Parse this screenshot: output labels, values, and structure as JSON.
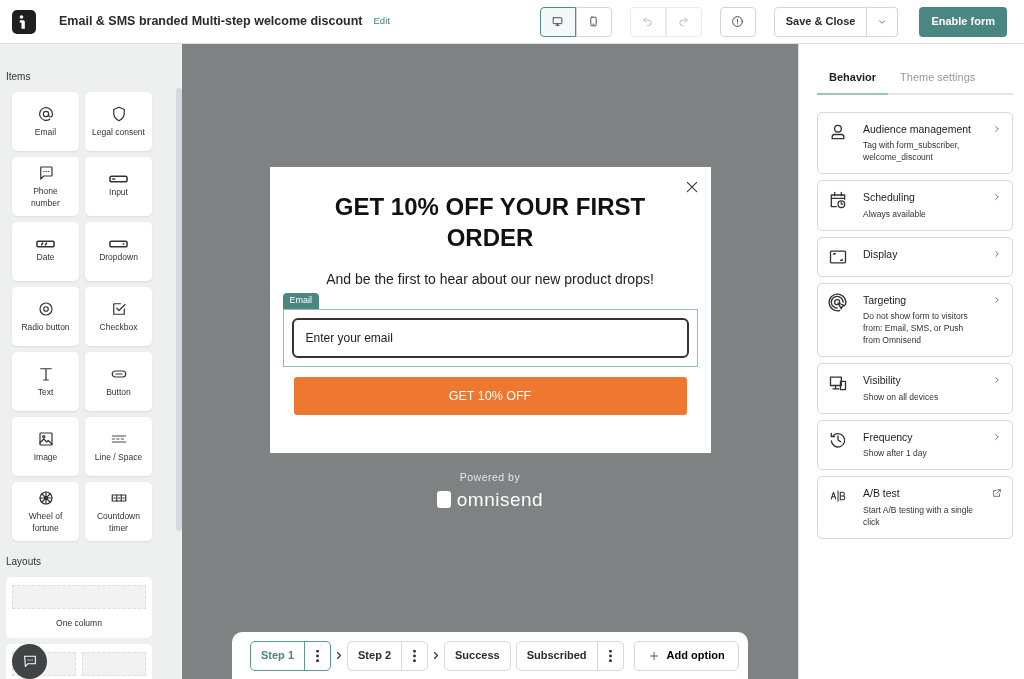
{
  "header": {
    "title": "Email & SMS branded Multi-step welcome discount",
    "edit_link": "Edit",
    "view_toggle": [
      {
        "selected": true
      },
      {
        "selected": false
      }
    ],
    "history": [
      {
        "disabled": true
      },
      {
        "disabled": true
      }
    ],
    "save_button": "Save & Close",
    "enable_button": "Enable form"
  },
  "sidebar": {
    "items_heading": "Items",
    "items": [
      "Email",
      "Legal consent",
      "Phone number",
      "Input",
      "Date",
      "Dropdown",
      "Radio button",
      "Checkbox",
      "Text",
      "Button",
      "Image",
      "Line / Space",
      "Wheel of fortune",
      "Countdown timer"
    ],
    "layouts_heading": "Layouts",
    "layouts": [
      {
        "label": "One column",
        "kind": "single"
      },
      {
        "kind": "double"
      }
    ]
  },
  "popup": {
    "title": "GET 10% OFF YOUR FIRST ORDER",
    "subtitle": "And be the first to hear about our new product drops!",
    "field_tag": "Email",
    "placeholder": "Enter your email",
    "button": "GET 10% OFF"
  },
  "powered_by": {
    "label": "Powered by",
    "brand": "omnisend"
  },
  "steps": [
    {
      "label": "Step 1",
      "selected": true,
      "menu": true,
      "arrow_after": true
    },
    {
      "label": "Step 2",
      "selected": false,
      "menu": true,
      "arrow_after": true
    },
    {
      "label": "Success",
      "selected": false,
      "menu": false,
      "arrow_after": false
    },
    {
      "label": "Subscribed",
      "selected": false,
      "menu": true,
      "arrow_after": false
    }
  ],
  "add_option": "Add option",
  "panel": {
    "tabs": [
      {
        "label": "Behavior",
        "selected": true
      },
      {
        "label": "Theme settings",
        "selected": false
      }
    ],
    "settings": [
      {
        "title": "Audience management",
        "subtitle": "Tag with form_subscriber, welcome_discount",
        "kind": "chevron"
      },
      {
        "title": "Scheduling",
        "subtitle": "Always available",
        "kind": "chevron"
      },
      {
        "title": "Display",
        "kind": "chevron"
      },
      {
        "title": "Targeting",
        "subtitle": "Do not show form to visitors from: Email, SMS, or Push from Omnisend",
        "kind": "chevron"
      },
      {
        "title": "Visibility",
        "subtitle": "Show on all devices",
        "kind": "chevron"
      },
      {
        "title": "Frequency",
        "subtitle": "Show after 1 day",
        "kind": "chevron"
      },
      {
        "title": "A/B test",
        "subtitle": "Start A/B testing with a single click",
        "kind": "external"
      }
    ]
  }
}
